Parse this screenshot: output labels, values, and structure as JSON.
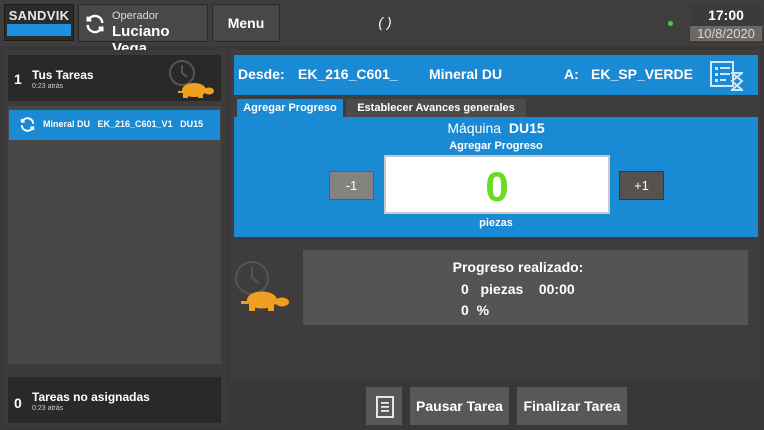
{
  "header": {
    "brand": "SANDVIK",
    "operator_label": "Operador",
    "operator_name": "Luciano Vega",
    "menu_label": "Menu",
    "status_text": "( )",
    "time": "17:00",
    "date": "10/8/2020"
  },
  "sidebar": {
    "tasks_count": "1",
    "tasks_title": "Tus Tareas",
    "tasks_ago": "0:23 atrás",
    "items": [
      {
        "label": "Mineral DU   EK_216_C601_V1   DU15"
      }
    ],
    "unassigned_count": "0",
    "unassigned_title": "Tareas no asignadas",
    "unassigned_ago": "0:23 atrás"
  },
  "route": {
    "from_label": "Desde:",
    "from_value": "EK_216_C601_",
    "material": "Mineral DU",
    "to_label": "A:",
    "to_value": "EK_SP_VERDE"
  },
  "tabs": [
    {
      "label": "Agregar Progreso",
      "active": true
    },
    {
      "label": "Establecer Avances generales",
      "active": false
    }
  ],
  "progress_form": {
    "machine_label": "Máquina",
    "machine_value": "DU15",
    "section_label": "Agregar Progreso",
    "minus_label": "-1",
    "plus_label": "+1",
    "count": "0",
    "unit": "piezas"
  },
  "done": {
    "title": "Progreso realizado:",
    "pieces_value": "0",
    "pieces_unit": "piezas",
    "time": "00:00",
    "percent_value": "0",
    "percent_unit": "%"
  },
  "footer": {
    "pause_label": "Pausar Tarea",
    "finish_label": "Finalizar Tarea"
  },
  "colors": {
    "accent_blue": "#1a8ad4",
    "counter_green": "#66dd22",
    "turtle_orange": "#f0a020"
  }
}
